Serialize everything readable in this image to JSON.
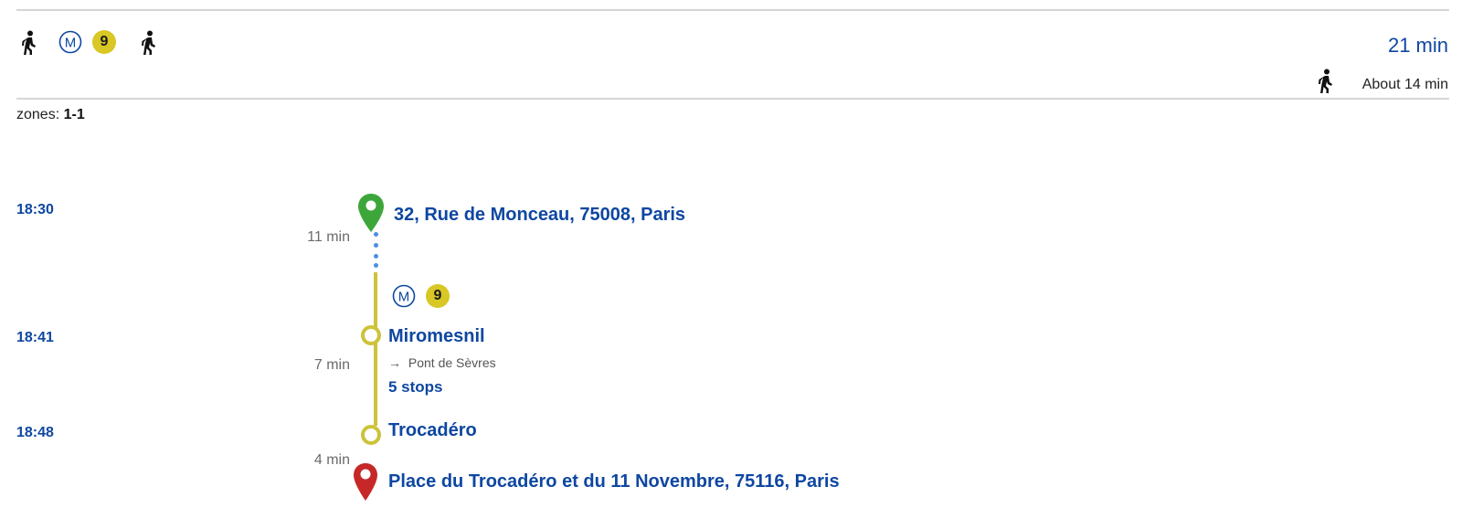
{
  "header": {
    "modes": [
      "walk-icon",
      "metro-icon",
      "line-badge",
      "walk-icon"
    ],
    "metro_letter": "M",
    "line": "9",
    "line_color": "#d8c725",
    "total_duration": "21 min",
    "walk_summary": "About 14 min"
  },
  "zones": {
    "label": "zones:",
    "value": "1-1"
  },
  "timeline": {
    "times": [
      "18:30",
      "18:41",
      "18:48"
    ],
    "origin": "32, Rue de Monceau, 75008, Paris",
    "walk1_duration": "11 min",
    "metro_letter": "M",
    "line": "9",
    "board_stop": "Miromesnil",
    "direction_arrow": "→",
    "direction": "Pont de Sèvres",
    "ride_duration": "7 min",
    "stops_count": "5 stops",
    "alight_stop": "Trocadéro",
    "walk2_duration": "4 min",
    "destination": "Place du Trocadéro et du 11 Novembre, 75116, Paris"
  },
  "colors": {
    "accent": "#0e47a1",
    "origin_pin": "#3da63a",
    "destination_pin": "#c62828",
    "line_track": "#cdc33a",
    "walk_dots": "#4a90e2"
  }
}
